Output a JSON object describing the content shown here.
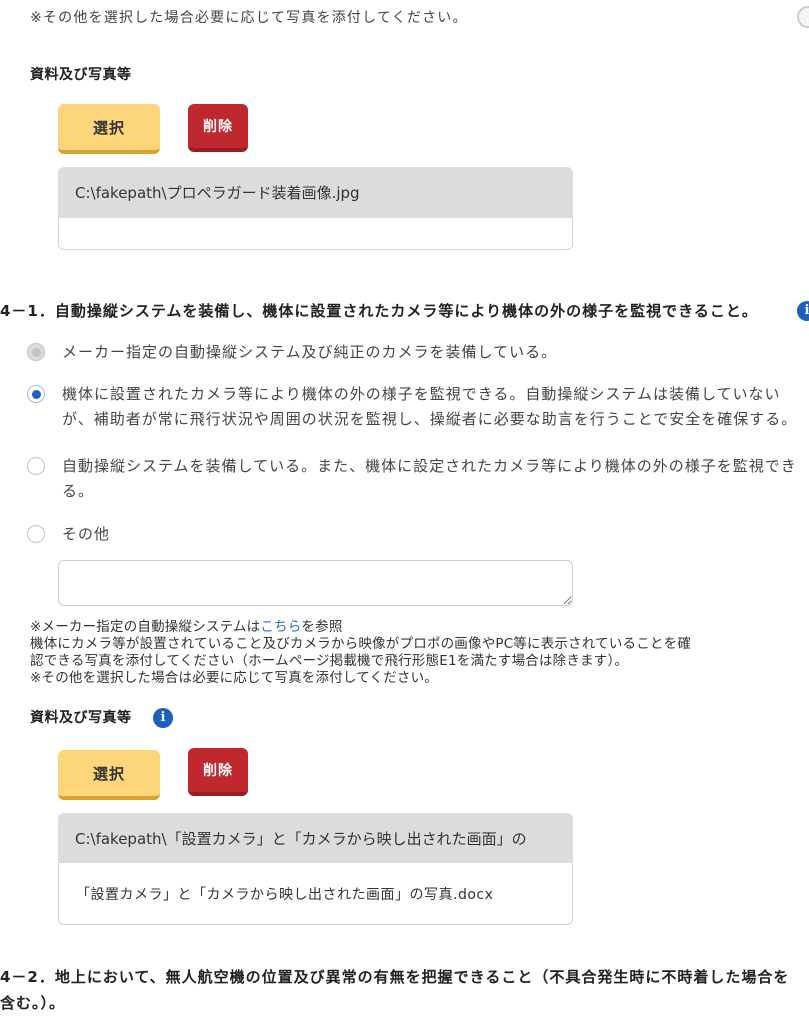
{
  "top_note": "※その他を選択した場合必要に応じて写真を添付してください。",
  "attachments_1": {
    "label": "資料及び写真等",
    "select_label": "選択",
    "delete_label": "削除",
    "file_path": "C:\\fakepath\\プロペラガード装着画像.jpg",
    "file_name": ""
  },
  "q4_1": {
    "heading": "4－1．自動操縦システムを装備し、機体に設置されたカメラ等により機体の外の様子を監視できること。",
    "info_icon": "info-icon",
    "options": [
      {
        "lines": [
          "メーカー指定の自動操縦システム及び純正のカメラを装備している。"
        ],
        "selected": false,
        "disabled": true
      },
      {
        "lines": [
          "機体に設置されたカメラ等により機体の外の様子を監視できる。自動操縦システムは装備していない",
          "が、補助者が常に飛行状況や周囲の状況を監視し、操縦者に必要な助言を行うことで安全を確保する。"
        ],
        "selected": true,
        "disabled": false
      },
      {
        "lines": [
          "自動操縦システムを装備している。また、機体に設定されたカメラ等により機体の外の様子を監視でき",
          "る。"
        ],
        "selected": false,
        "disabled": false
      },
      {
        "lines": [
          "その他"
        ],
        "selected": false,
        "disabled": false
      }
    ],
    "other_text": "",
    "notes": {
      "line1_prefix": "※メーカー指定の自動操縦システムは",
      "line1_link": "こちら",
      "line1_suffix": "を参照",
      "line2": "機体にカメラ等が設置されていること及びカメラから映像がプロポの画像やPC等に表示されていることを確",
      "line3": "認できる写真を添付してください（ホームページ掲載機で飛行形態E1を満たす場合は除きます）。",
      "line4": "※その他を選択した場合は必要に応じて写真を添付してください。"
    }
  },
  "attachments_2": {
    "label": "資料及び写真等",
    "info_icon": "info-icon",
    "select_label": "選択",
    "delete_label": "削除",
    "file_path": "C:\\fakepath\\「設置カメラ」と「カメラから映し出された画面」の",
    "file_name": "「設置カメラ」と「カメラから映し出された画面」の写真.docx"
  },
  "q4_2": {
    "heading_lines": [
      "4－2．地上において、無人航空機の位置及び異常の有無を把握できること（不具合発生時に不時着した場合を",
      "含む。）。"
    ]
  },
  "colors": {
    "accent": "#1f5fbf",
    "select_button": "#fdd57a",
    "delete_button": "#c0282f",
    "link": "#2a6bd0"
  }
}
